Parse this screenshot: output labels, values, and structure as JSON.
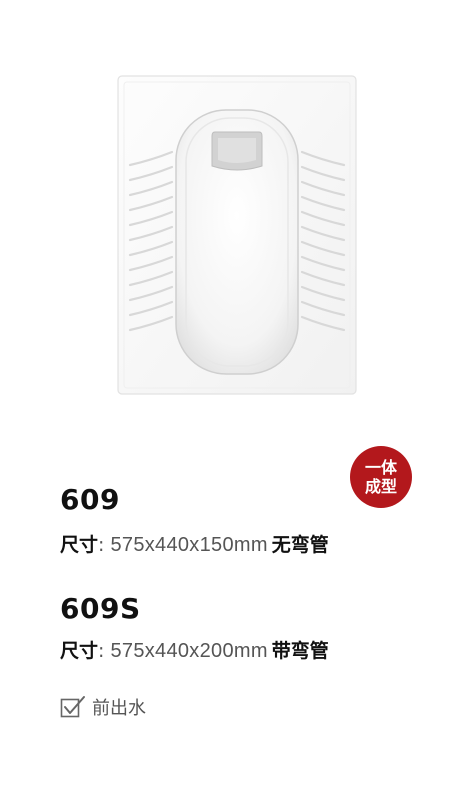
{
  "badge": {
    "line1": "一体",
    "line2": "成型"
  },
  "products": [
    {
      "model": "609",
      "size_label": "尺寸",
      "colon": ": ",
      "dimensions": "575x440x150mm",
      "note": "无弯管"
    },
    {
      "model": "609S",
      "size_label": "尺寸",
      "colon": ": ",
      "dimensions": "575x440x200mm",
      "note": "带弯管"
    }
  ],
  "feature": {
    "icon": "checkbox-checked-icon",
    "label": "前出水"
  },
  "colors": {
    "badge": "#b3181c",
    "text": "#1a1a1a",
    "muted": "#555555"
  }
}
